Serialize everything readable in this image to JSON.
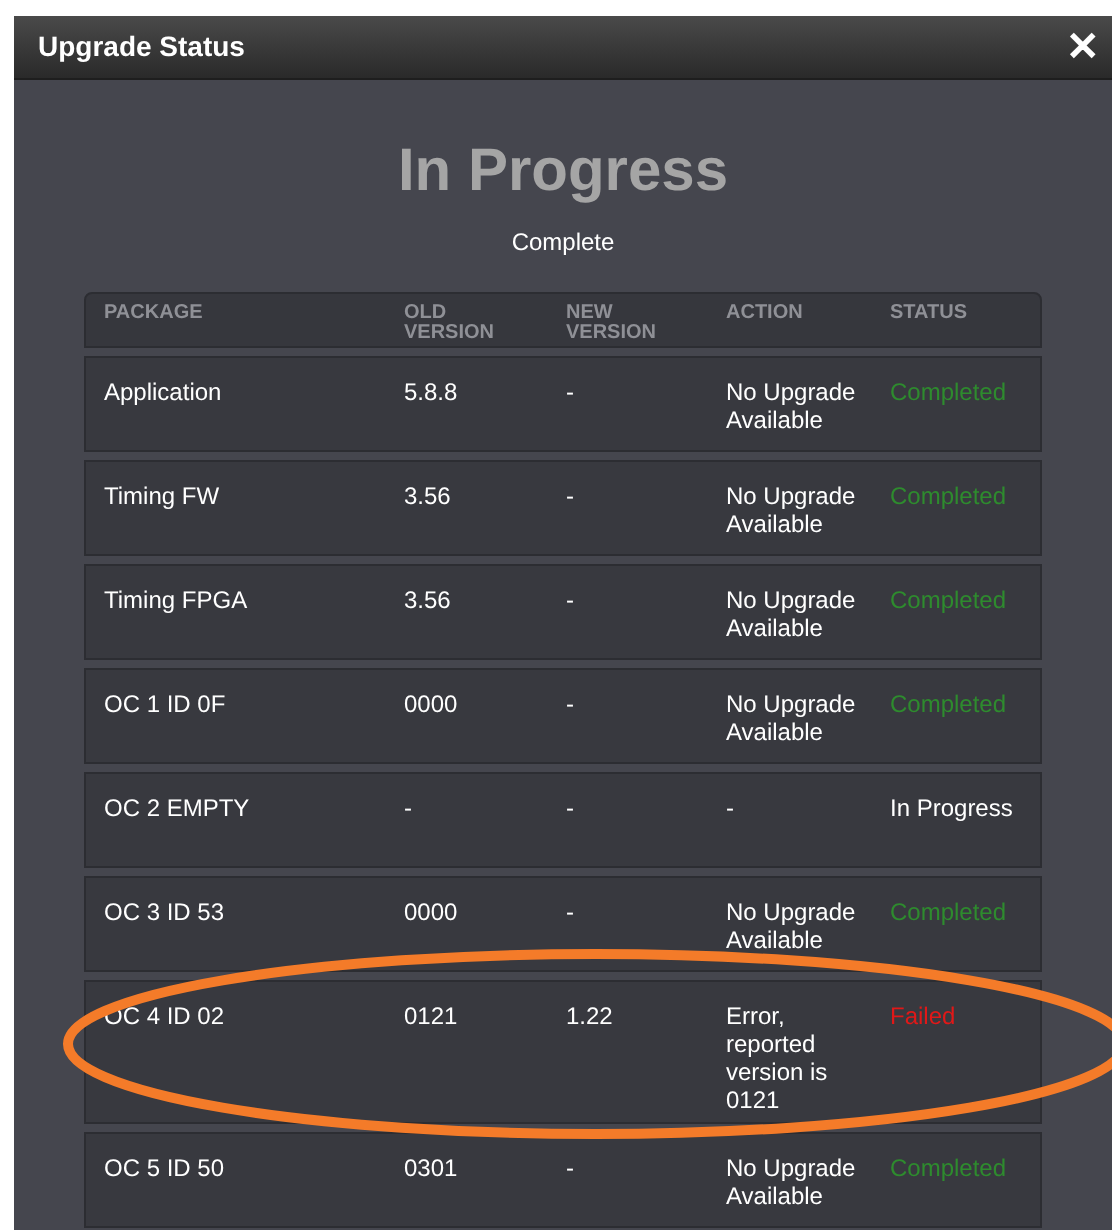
{
  "dialog": {
    "title": "Upgrade Status",
    "close": "✕"
  },
  "heading": "In Progress",
  "subheading": "Complete",
  "table": {
    "columns": [
      "PACKAGE",
      "OLD VERSION",
      "NEW VERSION",
      "ACTION",
      "STATUS"
    ],
    "rows": [
      {
        "package": "Application",
        "old_version": "5.8.8",
        "new_version": "-",
        "action": "No Upgrade Available",
        "status": "Completed",
        "color": "#2e8b2e",
        "circled": false
      },
      {
        "package": "Timing FW",
        "old_version": "3.56",
        "new_version": "-",
        "action": "No Upgrade Available",
        "status": "Completed",
        "color": "#2e8b2e",
        "circled": false
      },
      {
        "package": "Timing FPGA",
        "old_version": "3.56",
        "new_version": "-",
        "action": "No Upgrade Available",
        "status": "Completed",
        "color": "#2e8b2e",
        "circled": false
      },
      {
        "package": "OC 1 ID 0F",
        "old_version": "0000",
        "new_version": "-",
        "action": "No Upgrade Available",
        "status": "Completed",
        "color": "#2e8b2e",
        "circled": false
      },
      {
        "package": "OC 2 EMPTY",
        "old_version": "-",
        "new_version": "-",
        "action": "-",
        "status": "In Progress",
        "color": "#ffffff",
        "circled": false
      },
      {
        "package": "OC 3 ID 53",
        "old_version": "0000",
        "new_version": "-",
        "action": "No Upgrade Available",
        "status": "Completed",
        "color": "#2e8b2e",
        "circled": false
      },
      {
        "package": "OC 4 ID 02",
        "old_version": "0121",
        "new_version": "1.22",
        "action": "Error, reported version is 0121",
        "status": "Failed",
        "color": "#e01818",
        "circled": true
      },
      {
        "package": "OC 5 ID 50",
        "old_version": "0301",
        "new_version": "-",
        "action": "No Upgrade Available",
        "status": "Completed",
        "color": "#2e8b2e",
        "circled": false
      }
    ]
  }
}
